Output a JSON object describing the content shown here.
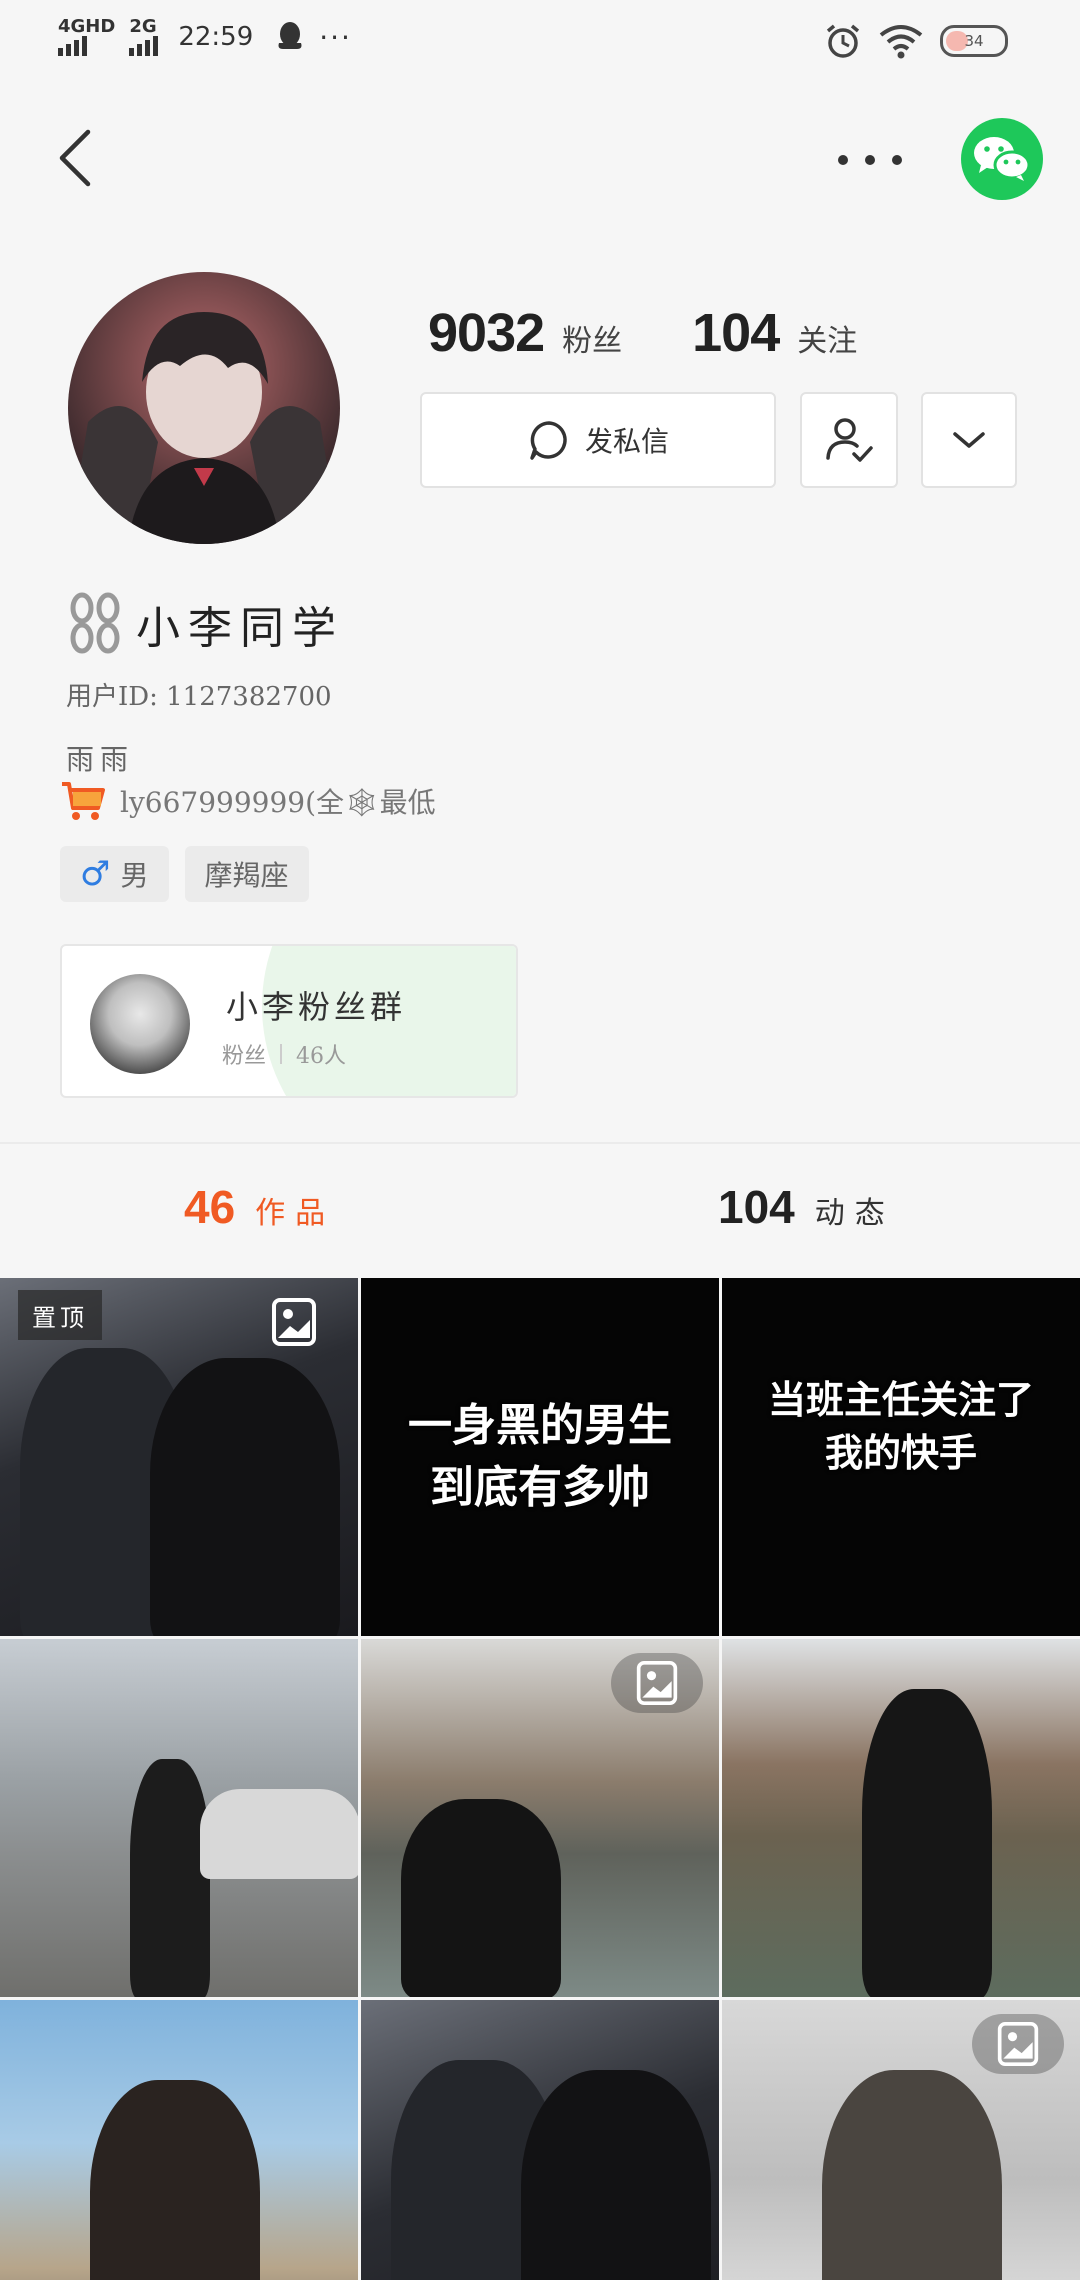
{
  "status_bar": {
    "network_1": "4GHD",
    "network_2": "2G",
    "time": "22:59",
    "more": "···",
    "battery": "34"
  },
  "profile": {
    "fans_count": "9032",
    "fans_label": "粉丝",
    "following_count": "104",
    "following_label": "关注",
    "message_button": "发私信",
    "name": "小李同学",
    "user_id": "用户ID: 1127382700",
    "bio": "雨雨",
    "shop_text": "ly667999999(全🕸最低",
    "tags": [
      {
        "icon": "male-icon",
        "label": "男"
      },
      {
        "label": "摩羯座"
      }
    ]
  },
  "fan_group": {
    "name": "小李粉丝群",
    "meta_label": "粉丝",
    "meta_count": "46人"
  },
  "tabs": {
    "works_count": "46",
    "works_label": "作品",
    "moments_count": "104",
    "moments_label": "动态"
  },
  "grid": {
    "pinned_label": "置顶",
    "caption_2": "一身黑的男生\n到底有多帅",
    "caption_3": "当班主任关注了\n我的快手"
  },
  "colors": {
    "accent": "#f05a23",
    "wechat": "#1ec85a",
    "background": "#f6f6f6"
  }
}
